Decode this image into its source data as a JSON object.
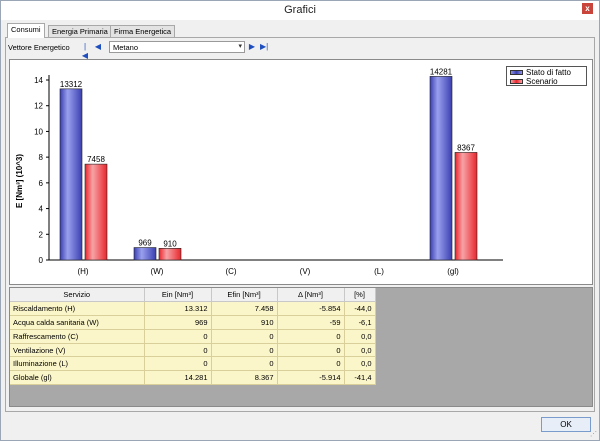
{
  "window": {
    "title": "Grafici",
    "close_glyph": "x"
  },
  "tabs": [
    {
      "label": "Consumi",
      "active": true
    },
    {
      "label": "Energia Primaria",
      "active": false
    },
    {
      "label": "Firma Energetica",
      "active": false
    }
  ],
  "toolbar": {
    "label": "Vettore Energetico",
    "first_icon": "first-page-icon",
    "prev_icon": "prev-icon",
    "next_icon": "next-icon",
    "last_icon": "last-page-icon",
    "selected_vector": "Metano"
  },
  "colors": {
    "stato_di_fatto": "#3a3fb0",
    "scenario": "#e8262d"
  },
  "chart_data": {
    "type": "bar",
    "ylabel": "E [Nm³] (10^3)",
    "xlabel": "",
    "title": "",
    "categories": [
      "(H)",
      "(W)",
      "(C)",
      "(V)",
      "(L)",
      "(gl)"
    ],
    "ylim": [
      0,
      14
    ],
    "yticks": [
      0,
      2,
      4,
      6,
      8,
      10,
      12,
      14
    ],
    "grid": false,
    "legend_position": "top-right",
    "series": [
      {
        "name": "Stato di fatto",
        "values": [
          13.312,
          0.969,
          0,
          0,
          0,
          14.281
        ],
        "labels": [
          "13312",
          "969",
          "",
          "",
          "",
          "14281"
        ]
      },
      {
        "name": "Scenario",
        "values": [
          7.458,
          0.91,
          0,
          0,
          0,
          8.367
        ],
        "labels": [
          "7458",
          "910",
          "",
          "",
          "",
          "8367"
        ]
      }
    ]
  },
  "table": {
    "headers": [
      "Servizio",
      "Ein [Nm³]",
      "Efin [Nm³]",
      "Δ [Nm³]",
      "[%]"
    ],
    "rows": [
      [
        "Riscaldamento (H)",
        "13.312",
        "7.458",
        "-5.854",
        "-44,0"
      ],
      [
        "Acqua calda sanitaria (W)",
        "969",
        "910",
        "-59",
        "-6,1"
      ],
      [
        "Raffrescamento (C)",
        "0",
        "0",
        "0",
        "0,0"
      ],
      [
        "Ventilazione (V)",
        "0",
        "0",
        "0",
        "0,0"
      ],
      [
        "Illuminazione (L)",
        "0",
        "0",
        "0",
        "0,0"
      ],
      [
        "Globale (gl)",
        "14.281",
        "8.367",
        "-5.914",
        "-41,4"
      ]
    ]
  },
  "ok_label": "OK"
}
